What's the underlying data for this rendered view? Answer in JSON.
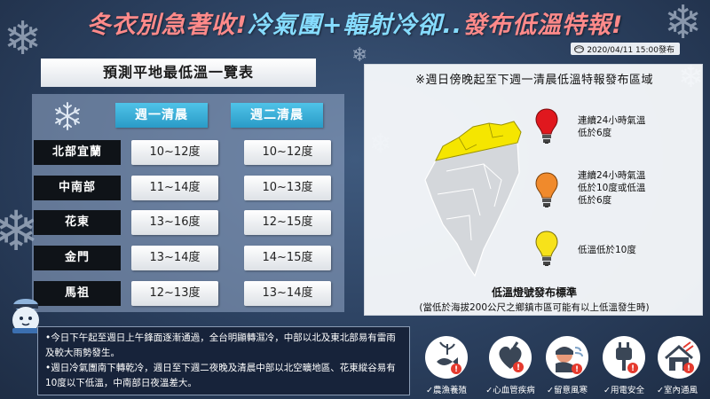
{
  "header": {
    "headline_part_1": "冬衣別急著收!",
    "headline_part_2": "冷氣團+輻射冷卻..",
    "headline_part_3": "發布低溫特報!",
    "issue_date": "2020/04/11 15:00發布"
  },
  "table": {
    "title": "預測平地最低溫一覽表",
    "columns": [
      "週一清晨",
      "週二清晨"
    ],
    "rows": [
      {
        "region": "北部宜蘭",
        "mon": "10~12度",
        "tue": "10~12度"
      },
      {
        "region": "中南部",
        "mon": "11~14度",
        "tue": "10~13度"
      },
      {
        "region": "花東",
        "mon": "13~16度",
        "tue": "12~15度"
      },
      {
        "region": "金門",
        "mon": "13~14度",
        "tue": "14~15度"
      },
      {
        "region": "馬祖",
        "mon": "12~13度",
        "tue": "13~14度"
      }
    ]
  },
  "map": {
    "title": "※週日傍晚起至下週一清晨低溫特報發布區域",
    "highlight_color": "#f5e600",
    "legend": [
      {
        "color": "#e0181e",
        "lines": [
          "連續24小時氣溫",
          "低於6度"
        ]
      },
      {
        "color": "#f08a2c",
        "lines": [
          "連續24小時氣溫",
          "低於10度或低溫",
          "低於6度"
        ]
      },
      {
        "color": "#f7e21a",
        "lines": [
          "低溫低於10度"
        ]
      }
    ],
    "standard_title": "低溫燈號發布標準",
    "standard_note": "(當低於海拔200公尺之鄉鎮市區可能有以上低溫發生時)"
  },
  "notes": [
    "•今日下午起至週日上午鋒面逐漸通過，全台明顯轉濕冷，中部以北及東北部易有雷雨及較大雨勢發生。",
    "•週日冷氣團南下轉乾冷，週日至下週二夜晚及清晨中部以北空曠地區、花東縱谷易有10度以下低溫，中南部日夜溫差大。"
  ],
  "warnings": [
    {
      "icon": "fish-plant-icon",
      "label": "✓農漁養殖"
    },
    {
      "icon": "heart-icon",
      "label": "✓心血管疾病"
    },
    {
      "icon": "wind-person-icon",
      "label": "✓留意風寒"
    },
    {
      "icon": "plug-icon",
      "label": "✓用電安全"
    },
    {
      "icon": "house-icon",
      "label": "✓室內通風"
    }
  ],
  "colors": {
    "background": "#2b405f",
    "header_red": "#ff8a8a",
    "header_cyan": "#86dcff",
    "column_header": "#2a9bc7"
  }
}
